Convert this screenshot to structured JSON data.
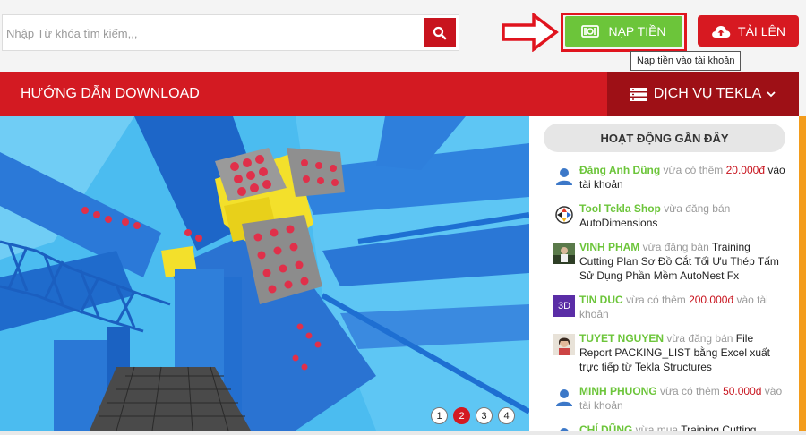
{
  "search": {
    "placeholder": "Nhập Từ khóa tìm kiếm,,,"
  },
  "header": {
    "nap_tien_label": "NẠP TIỀN",
    "tai_len_label": "TẢI LÊN",
    "tooltip": "Nạp tiền vào tài khoản"
  },
  "nav": {
    "title": "HƯỚNG DẪN DOWNLOAD",
    "dich_vu_label": "DỊCH VỤ TEKLA"
  },
  "slider": {
    "pages": [
      "1",
      "2",
      "3",
      "4"
    ],
    "active_page": "2"
  },
  "sidebar": {
    "heading": "HOẠT ĐỘNG GẦN ĐÂY",
    "items": [
      {
        "user": "Đặng Anh Dũng",
        "action": " vừa có thêm ",
        "amount": "20.000đ",
        "rest": " vào tài khoản",
        "avatar": "person-icon"
      },
      {
        "user": "Tool Tekla Shop",
        "action": " vừa đăng bán ",
        "amount": "",
        "rest": "AutoDimensions",
        "avatar": "shop-logo-icon"
      },
      {
        "user": "VINH PHAM",
        "action": " vừa đăng bán ",
        "amount": "",
        "rest": "Training Cutting Plan Sơ Đồ Cắt Tối Ưu Thép Tấm Sử Dụng Phần Mềm AutoNest Fx",
        "avatar": "photo-avatar"
      },
      {
        "user": "TIN DUC",
        "action": " vừa có thêm ",
        "amount": "200.000đ",
        "rest": " vào tài khoản",
        "avatar": "3d-badge",
        "avatar_text": "3D"
      },
      {
        "user": "TUYET NGUYEN",
        "action": " vừa đăng bán ",
        "amount": "",
        "rest": "File Report PACKING_LIST bằng Excel xuất trực tiếp từ Tekla Structures",
        "avatar": "photo-avatar"
      },
      {
        "user": "MINH PHUONG",
        "action": " vừa có thêm ",
        "amount": "50.000đ",
        "rest": " vào tài khoản",
        "avatar": "person-icon"
      },
      {
        "user": "CHÍ DŨNG",
        "action": " vừa mua ",
        "amount": "",
        "rest": "Training Cutting",
        "avatar": "person-icon"
      }
    ]
  },
  "colors": {
    "brand_red": "#d31a22",
    "dark_red": "#9e1016",
    "green": "#6cc53a",
    "orange_strip": "#f39c1c"
  }
}
